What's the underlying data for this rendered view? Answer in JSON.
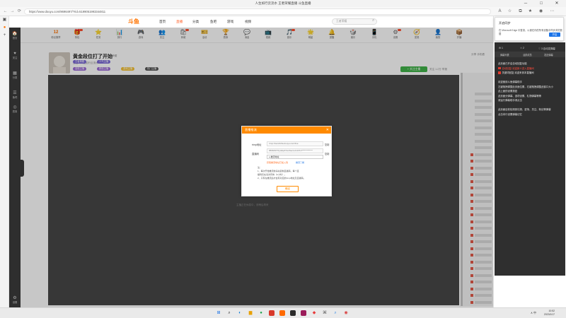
{
  "window": {
    "title": "人生如行云流水 王者荣耀直播 斗鱼直播",
    "controls": [
      "─",
      "□",
      "✕"
    ]
  },
  "browser": {
    "url": "https://www.douyu.com/9696497/?rid=5199051993344811",
    "back": "←",
    "reload": "⟳",
    "forward": "→"
  },
  "site": {
    "logo": "斗鱼",
    "nav": [
      "首页",
      "直播",
      "分类",
      "鱼吧",
      "游戏",
      "视频"
    ],
    "search_placeholder": "王者荣耀",
    "icon_items": [
      {
        "icon": "12",
        "label": "粉丝徽章",
        "name": "fans-badge"
      },
      {
        "icon": "🎁",
        "label": "背包",
        "name": "gift"
      },
      {
        "icon": "⭐",
        "label": "任务",
        "name": "task"
      },
      {
        "icon": "📊",
        "label": "排行",
        "name": "rank"
      },
      {
        "icon": "🎮",
        "label": "游戏",
        "name": "game"
      },
      {
        "icon": "👥",
        "label": "关注",
        "name": "follow"
      },
      {
        "icon": "🛍",
        "label": "商城",
        "name": "shop"
      },
      {
        "icon": "🎫",
        "label": "活动",
        "name": "event"
      },
      {
        "icon": "🏆",
        "label": "赛事",
        "name": "match"
      },
      {
        "icon": "💬",
        "label": "消息",
        "name": "message"
      },
      {
        "icon": "📺",
        "label": "视频",
        "name": "video"
      },
      {
        "icon": "🎵",
        "label": "音乐",
        "name": "music"
      },
      {
        "icon": "🌟",
        "label": "明星",
        "name": "star"
      },
      {
        "icon": "🔔",
        "label": "提醒",
        "name": "notify"
      },
      {
        "icon": "🎲",
        "label": "娱乐",
        "name": "fun"
      },
      {
        "icon": "📱",
        "label": "手机",
        "name": "mobile"
      },
      {
        "icon": "⚙",
        "label": "设置",
        "name": "settings"
      },
      {
        "icon": "🧭",
        "label": "发现",
        "name": "discover"
      },
      {
        "icon": "👤",
        "label": "我的",
        "name": "me"
      },
      {
        "icon": "📦",
        "label": "开播",
        "name": "broadcast"
      }
    ],
    "left_nav": [
      {
        "icon": "🏠",
        "label": "首页"
      },
      {
        "icon": "♥",
        "label": "关注"
      },
      {
        "icon": "▦",
        "label": "分类"
      },
      {
        "icon": "☰",
        "label": "鱼吧"
      },
      {
        "icon": "◎",
        "label": "赛事"
      },
      {
        "icon": "⚙",
        "label": "设置"
      }
    ]
  },
  "room": {
    "title": "黄金段位打了开始",
    "tag": "王者荣耀",
    "sub": "主播：人生如行云流水",
    "badges": [
      "王者荣耀",
      "人气主播",
      "高能主播",
      "颜值主播",
      "游戏主播",
      "热门主播"
    ],
    "badge_colors": [
      "#7c6ad6",
      "#7c6ad6",
      "#9b6ad6",
      "#9b6ad6",
      "#f4c033",
      "#555555"
    ],
    "follow_label": "+ 关注主播",
    "count_text": "关注 1.2万  举报",
    "right_text": "分享  手机看"
  },
  "player": {
    "footer_text": "主播正在休息中，请稍后再来"
  },
  "modal": {
    "title": "直播推流",
    "close": "✕",
    "rtmp_label": "rtmp地址",
    "rtmp_value": "rtmp://sendtc3a.douyu.com/live",
    "stream_label": "直播码",
    "stream_value": "9696497r0yAEpA?wsSecret=d37cf*************",
    "copy_label": "复制",
    "select_value": "e-推流地址",
    "link1": "获取推流地址已加入到",
    "link2": "推流了解",
    "notes": [
      "注：",
      "1、每次开始推流前请先复制直播码，每个直",
      "播码仅在当次有效（2小时）。",
      "2、只有在推流后才会有对应的rtmp地址及直播码。"
    ],
    "ok_label": "确定"
  },
  "sync_popup": {
    "title": "开启同步",
    "text": "在 Microsoft Edge 中登录，以便在你的所有设备中同步浏览数据",
    "button": "开启"
  },
  "danmu_panel": {
    "tabs": [
      "⚙ 1",
      "☆ 2",
      "♡ 3 自动发弹幕"
    ],
    "subtabs": [
      "弹幕列表",
      "活跃成员",
      "发送弹幕"
    ],
    "lines": [
      {
        "text": "此页面已开启自动回复功能",
        "red": false,
        "sq": false
      },
      {
        "text": "自动回复·欢迎新人进入直播间",
        "red": true,
        "sq": true
      },
      {
        "text": "关键词回复 欢迎来到本直播间",
        "red": false,
        "sq": true
      },
      {
        "text": "",
        "red": false,
        "sq": false
      },
      {
        "text": "欢迎使用斗鱼弹幕助手",
        "red": false,
        "sq": false
      },
      {
        "text": "左键拖拽调整此页面位置，右键拖拽调整此窗口大小",
        "red": false,
        "sq": false
      },
      {
        "text": "此上面的设置按钮",
        "red": false,
        "sq": false
      },
      {
        "text": "此页面分弹幕、选项设置、礼物弹幕等等",
        "red": false,
        "sq": false
      },
      {
        "text": "请运行弹幕助手请点击",
        "red": false,
        "sq": false
      },
      {
        "text": "",
        "red": false,
        "sq": false
      },
      {
        "text": "此页面目前检测到礼物、进场、关注、粉丝等弹幕",
        "red": false,
        "sq": false
      },
      {
        "text": "点击本行设置弹幕记忆",
        "red": false,
        "sq": false
      }
    ]
  },
  "taskbar": {
    "time": "10:52",
    "date": "2023/1/17",
    "tray": "∧ 中"
  }
}
